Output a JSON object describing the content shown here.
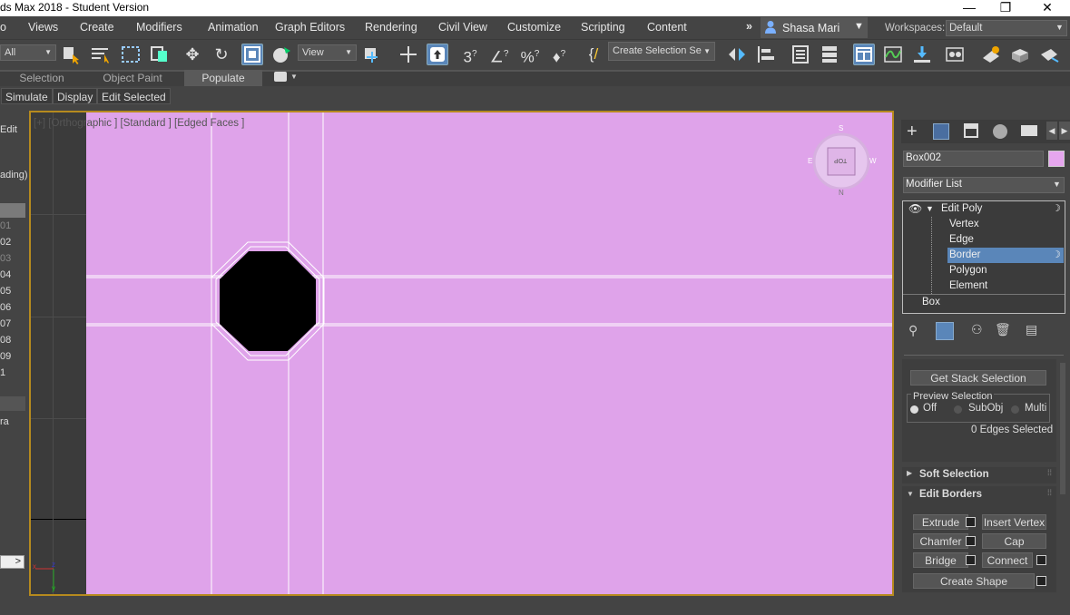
{
  "window": {
    "title": "ds Max 2018 - Student Version",
    "minimize": "—",
    "restore": "❐",
    "close": "✕"
  },
  "menu": {
    "items": [
      "o",
      "Views",
      "Create",
      "Modifiers",
      "Animation",
      "Graph Editors",
      "Rendering",
      "Civil View",
      "Customize",
      "Scripting",
      "Content"
    ],
    "more": "»",
    "user": "Shasa Mari",
    "workspaces_label": "Workspaces:",
    "workspace_value": "Default"
  },
  "toolbar": {
    "filter_value": "All",
    "refcoord_value": "View",
    "selection_set_placeholder": "Create Selection Se"
  },
  "ribbon": {
    "tabs": [
      "Selection",
      "Object Paint",
      "Populate"
    ],
    "active": "Populate"
  },
  "scene_explorer": {
    "tabs": [
      "Simulate",
      "Display",
      "Edit Selected"
    ]
  },
  "left_panel": {
    "rows": [
      "Edit",
      "ading)",
      "01",
      "02",
      "03",
      "04",
      "05",
      "06",
      "07",
      "08",
      "09",
      "1",
      "ra"
    ],
    "nav_arrow": ">"
  },
  "viewport": {
    "label": "[+] [Orthographic ] [Standard ] [Edged Faces ]",
    "viewcube_face": "TOP",
    "compass": {
      "n": "N",
      "s": "S",
      "e": "E",
      "w": "W"
    },
    "axis_x": "x",
    "axis_y": "y",
    "axis_z": "z"
  },
  "command_panel": {
    "object_name": "Box002",
    "object_color": "#e6a6ee",
    "modifier_list": "Modifier List",
    "stack": {
      "root": "Edit Poly",
      "subobjects": [
        "Vertex",
        "Edge",
        "Border",
        "Polygon",
        "Element"
      ],
      "selected": "Border",
      "base": "Box"
    },
    "get_stack_selection": "Get Stack Selection",
    "preview_selection": {
      "label": "Preview Selection",
      "options": [
        "Off",
        "SubObj",
        "Multi"
      ],
      "selected": "Off"
    },
    "selection_info": "0 Edges Selected",
    "rollouts": {
      "soft_selection": "Soft Selection",
      "edit_borders": "Edit Borders"
    },
    "edit_borders_buttons": {
      "extrude": "Extrude",
      "insert_vertex": "Insert Vertex",
      "chamfer": "Chamfer",
      "cap": "Cap",
      "bridge": "Bridge",
      "connect": "Connect",
      "create_shape": "Create Shape"
    }
  },
  "colors": {
    "viewport_bg": "#dfa3ea",
    "active_border": "#b68a1e",
    "highlight": "#5a86b9",
    "hole": "#000000"
  }
}
